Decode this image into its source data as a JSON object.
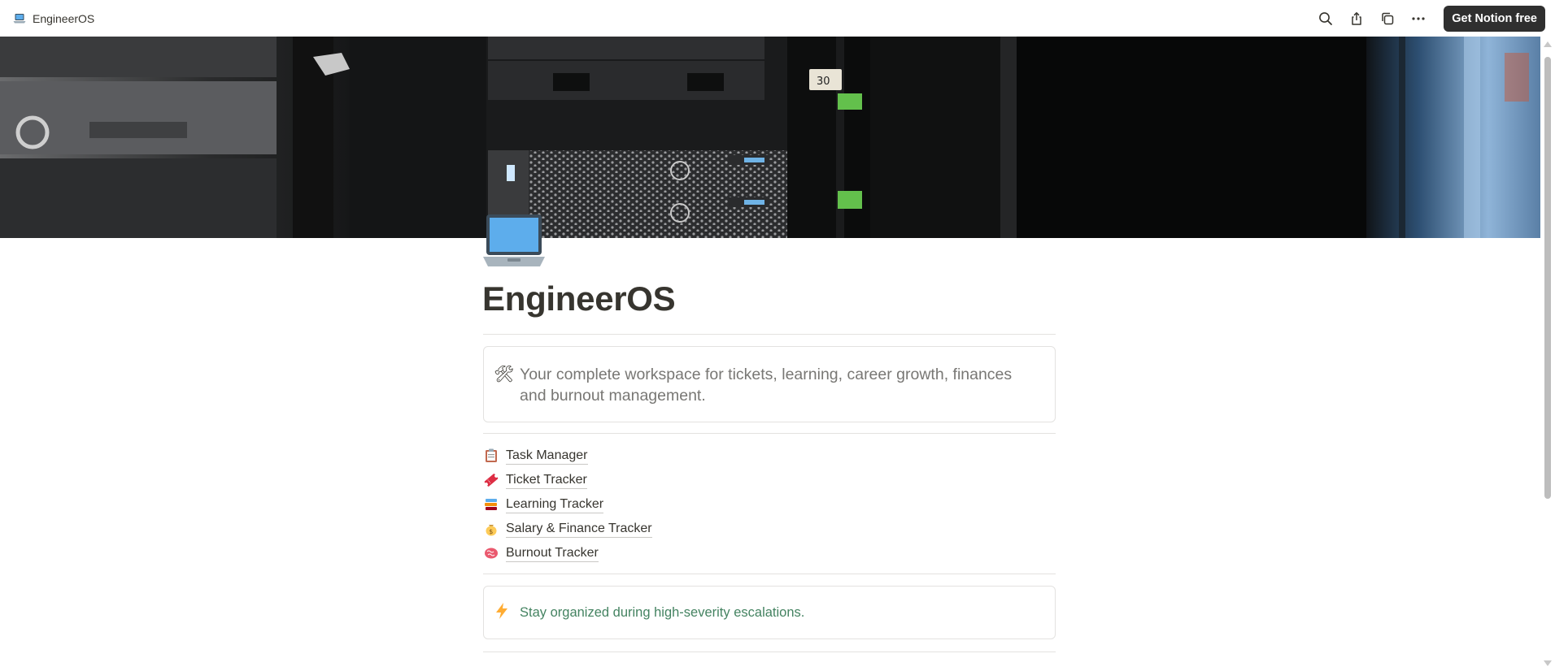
{
  "topbar": {
    "breadcrumb": {
      "title": "EngineerOS",
      "icon": "laptop-icon"
    },
    "actions": [
      {
        "name": "search-button",
        "icon": "search-icon"
      },
      {
        "name": "share-button",
        "icon": "share-icon"
      },
      {
        "name": "duplicate-button",
        "icon": "duplicate-icon"
      },
      {
        "name": "more-button",
        "icon": "more-horizontal-icon"
      }
    ],
    "cta_label": "Get Notion free"
  },
  "cover": {
    "subject": "server rack photo",
    "rack_label": "30"
  },
  "page": {
    "icon": "laptop-icon",
    "title": "EngineerOS",
    "callout_top": {
      "icon": "hammer-and-wrench-icon",
      "text": "Your complete workspace for tickets, learning, career growth, finances and burnout management."
    },
    "links": [
      {
        "icon": "clipboard-icon",
        "label": "Task Manager"
      },
      {
        "icon": "ticket-icon",
        "label": "Ticket Tracker"
      },
      {
        "icon": "books-icon",
        "label": "Learning Tracker"
      },
      {
        "icon": "money-bag-icon",
        "label": "Salary & Finance Tracker"
      },
      {
        "icon": "brain-icon",
        "label": "Burnout Tracker"
      }
    ],
    "callout_bottom": {
      "icon": "lightning-icon",
      "text": "Stay organized during high-severity escalations."
    }
  },
  "colors": {
    "text": "#37352f",
    "muted": "#787774",
    "green": "#448361",
    "cta_bg": "#2f2f2f",
    "border": "#e3e2e0"
  }
}
